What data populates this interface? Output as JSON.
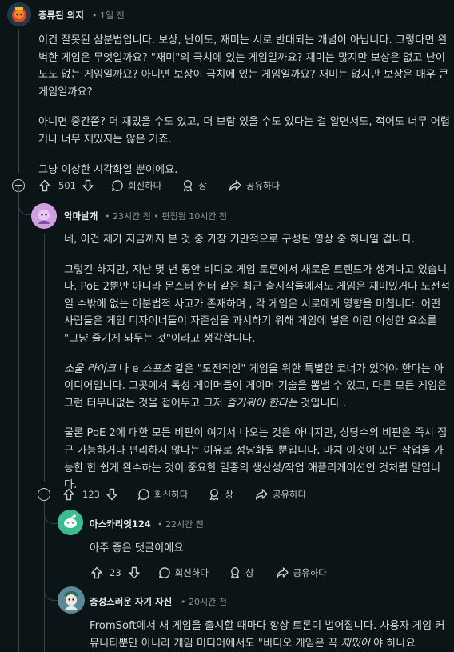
{
  "c1": {
    "username": "증류된 의지",
    "time": "1일 전",
    "paragraphs": [
      "이건 잘못된 삼분법입니다. 보상, 난이도, 재미는 서로 반대되는 개념이 아닙니다. 그렇다면 완벽한 게임은 무엇일까요? \"재미\"의 극치에 있는 게임일까요? 재미는 많지만 보상은 없고 난이도도 없는 게임일까요? 아니면 보상이 극치에 있는 게임일까요? 재미는 없지만 보상은 매우 큰 게임일까요?",
      "아니면 중간쯤? 더 재밌을 수도 있고, 더 보람 있을 수도 있다는 걸 알면서도, 적어도 너무 어렵거나 너무 재밌지는 않은 거죠.",
      "그냥 이상한 시각화일 뿐이에요."
    ],
    "votes": "501",
    "reply_label": "회신하다",
    "award_label": "상",
    "share_label": "공유하다"
  },
  "c2": {
    "username": "악마날개",
    "time": "23시간 전",
    "edited": "편집됨 10시간 전",
    "p1": "네, 이건 제가 지금까지 본 것 중 가장 기만적으로 구성된 영상 중 하나일 겁니다.",
    "p2": "그렇긴 하지만, 지난 몇 년 동안 비디오 게임 토론에서 새로운 트렌드가 생겨나고 있습니다. PoE 2뿐만 아니라 몬스터 헌터 같은 최근 출시작들에서도 게임은 재미있거나 도전적일 수밖에 없는 이분법적 사고가 존재하며 , 각 게임은 서로에게 영향을 미칩니다. 어떤 사람들은 게임 디자이너들이 자존심을 과시하기 위해 게임에 넣은 이런 이상한 요소를 \"그냥 즐기게 놔두는 것\"이라고 생각합니다.",
    "p3": {
      "e1": "소울 라이크",
      "t1": " 나 e ",
      "e2": "스포츠",
      "t2": " 같은 \"도전적인\" 게임을 위한 특별한 코너가 있어야 한다는 아이디어입니다. 그곳에서 독성 게이머들이 게이머 기술을 뽐낼 수 있고, 다른 모든 게임은 그런 터무니없는 것을 접어두고 그저 ",
      "e3": "즐거워야 한다는",
      "t3": " 것입니다 ."
    },
    "p4": "물론 PoE 2에 대한 모든 비판이 여기서 나오는 것은 아니지만, 상당수의 비판은 즉시 접근 가능하거나 편리하지 않다는 이유로 정당화될 뿐입니다. 마치 이것이 모든 작업을 가능한 한 쉽게 완수하는 것이 중요한 일종의 생산성/작업 애플리케이션인 것처럼 말입니다.",
    "votes": "123",
    "reply_label": "회신하다",
    "award_label": "상",
    "share_label": "공유하다"
  },
  "c3": {
    "username": "아스카리엇124",
    "time": "22시간 전",
    "text": "아주 좋은 댓글이에요",
    "votes": "23",
    "reply_label": "회신하다",
    "award_label": "상",
    "share_label": "공유하다"
  },
  "c4": {
    "username": "충성스러운 자기 자신",
    "time": "20시간 전",
    "text_a": "FromSoft에서 새 게임을 출시할 때마다 항상 토론이 벌어집니다. 사용자 게임 커뮤니티뿐만 아니라 게임 미디어에서도 \"비디오 게임은 꼭 ",
    "text_em": "재밌어",
    "text_b": " 야 하나요"
  },
  "colors": {
    "background": "#0b1416",
    "thread": "#3a4144",
    "meta": "#8a9396"
  },
  "icons": [
    "upvote-icon",
    "downvote-icon",
    "comment-icon",
    "award-icon",
    "share-icon",
    "collapse-icon"
  ]
}
